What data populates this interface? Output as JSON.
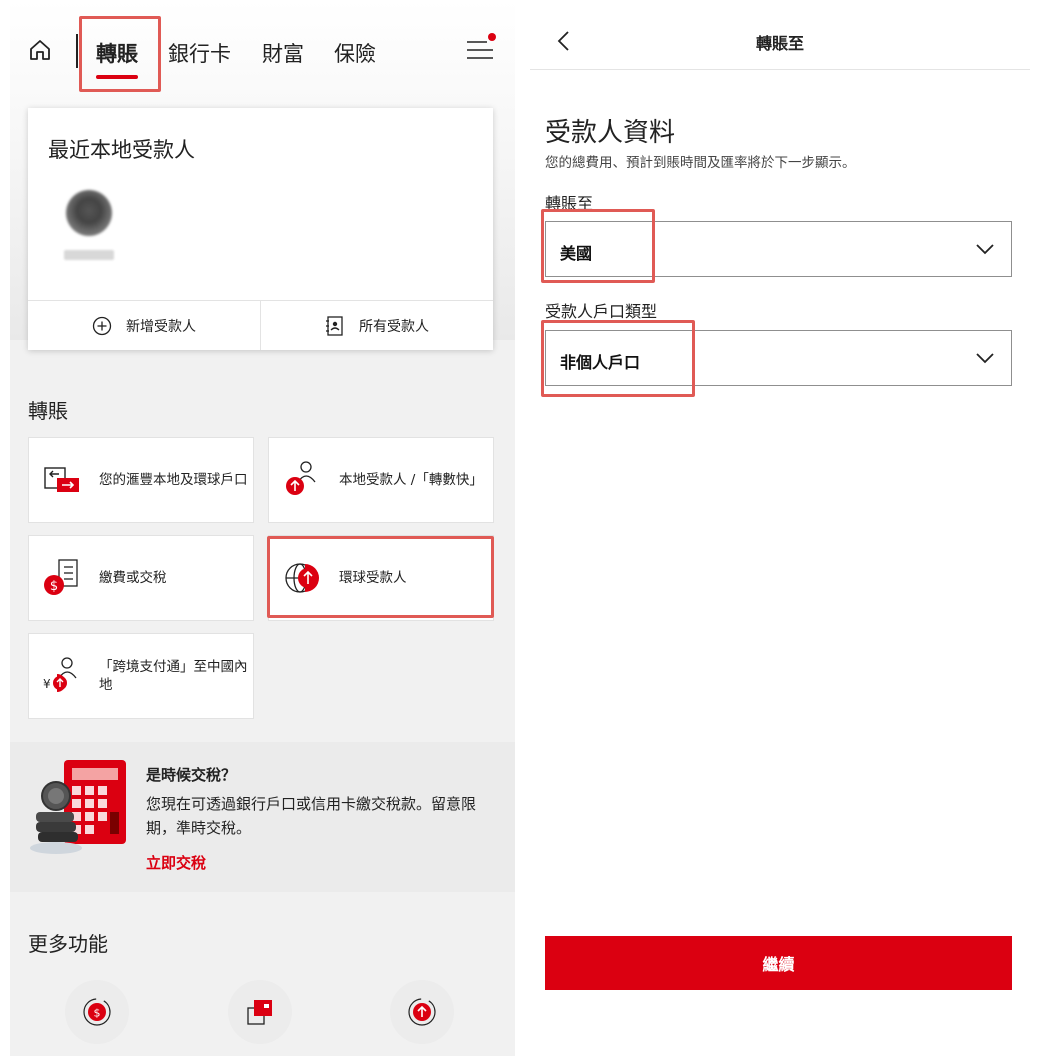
{
  "left": {
    "nav": {
      "tabs": [
        "轉賬",
        "銀行卡",
        "財富",
        "保險"
      ]
    },
    "recent": {
      "title": "最近本地受款人",
      "add_label": "新增受款人",
      "all_label": "所有受款人"
    },
    "transfer": {
      "section_title": "轉賬",
      "tiles": [
        "您的滙豐本地及環球戶口",
        "本地受款人 /「轉數快」",
        "繳費或交稅",
        "環球受款人",
        "「跨境支付通」至中國內地"
      ]
    },
    "promo": {
      "title": "是時候交稅？",
      "text": "您現在可透過銀行戶口或信用卡繳交稅款。留意限期，準時交稅。",
      "link": "立即交稅"
    },
    "more": {
      "section_title": "更多功能"
    }
  },
  "right": {
    "title": "轉賬至",
    "heading": "受款人資料",
    "subtitle": "您的總費用、預計到賬時間及匯率將於下一步顯示。",
    "field1": {
      "label": "轉賬至",
      "value": "美國"
    },
    "field2": {
      "label": "受款人戶口類型",
      "value": "非個人戶口"
    },
    "continue_label": "繼續"
  },
  "colors": {
    "brand_red": "#db0011",
    "highlight": "#e05a55"
  }
}
